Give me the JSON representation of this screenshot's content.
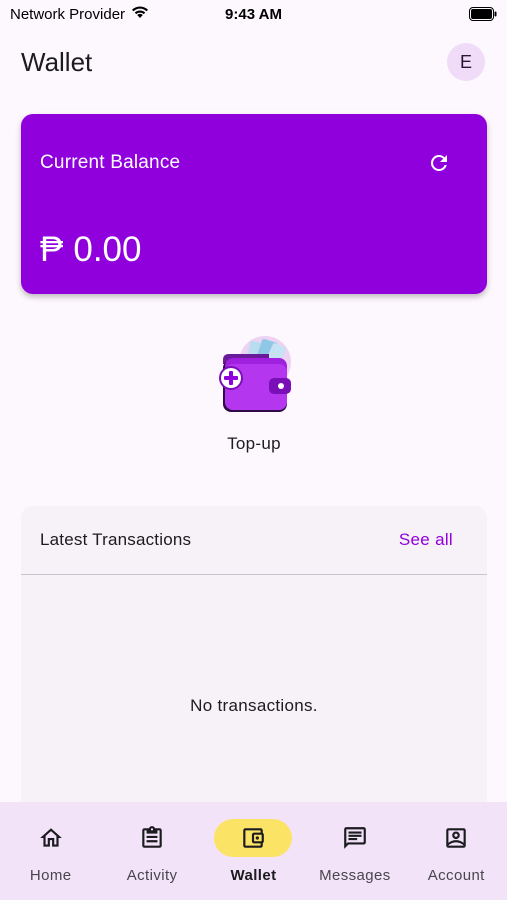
{
  "status_bar": {
    "carrier": "Network Provider",
    "time": "9:43 AM"
  },
  "app_bar": {
    "title": "Wallet",
    "avatar_initial": "E"
  },
  "balance": {
    "label": "Current Balance",
    "currency_symbol": "₱",
    "amount": "0.00",
    "refresh_icon": "refresh-icon",
    "card_color": "#9000dd"
  },
  "actions": {
    "topup_label": "Top-up",
    "topup_icon": "wallet-add-icon"
  },
  "transactions": {
    "title": "Latest Transactions",
    "see_all": "See all",
    "empty_message": "No transactions."
  },
  "nav": {
    "items": [
      {
        "label": "Home",
        "icon": "home-icon",
        "active": false
      },
      {
        "label": "Activity",
        "icon": "clipboard-icon",
        "active": false
      },
      {
        "label": "Wallet",
        "icon": "wallet-icon",
        "active": true
      },
      {
        "label": "Messages",
        "icon": "message-icon",
        "active": false
      },
      {
        "label": "Account",
        "icon": "account-icon",
        "active": false
      }
    ],
    "active_indicator_color": "#fbe366"
  }
}
